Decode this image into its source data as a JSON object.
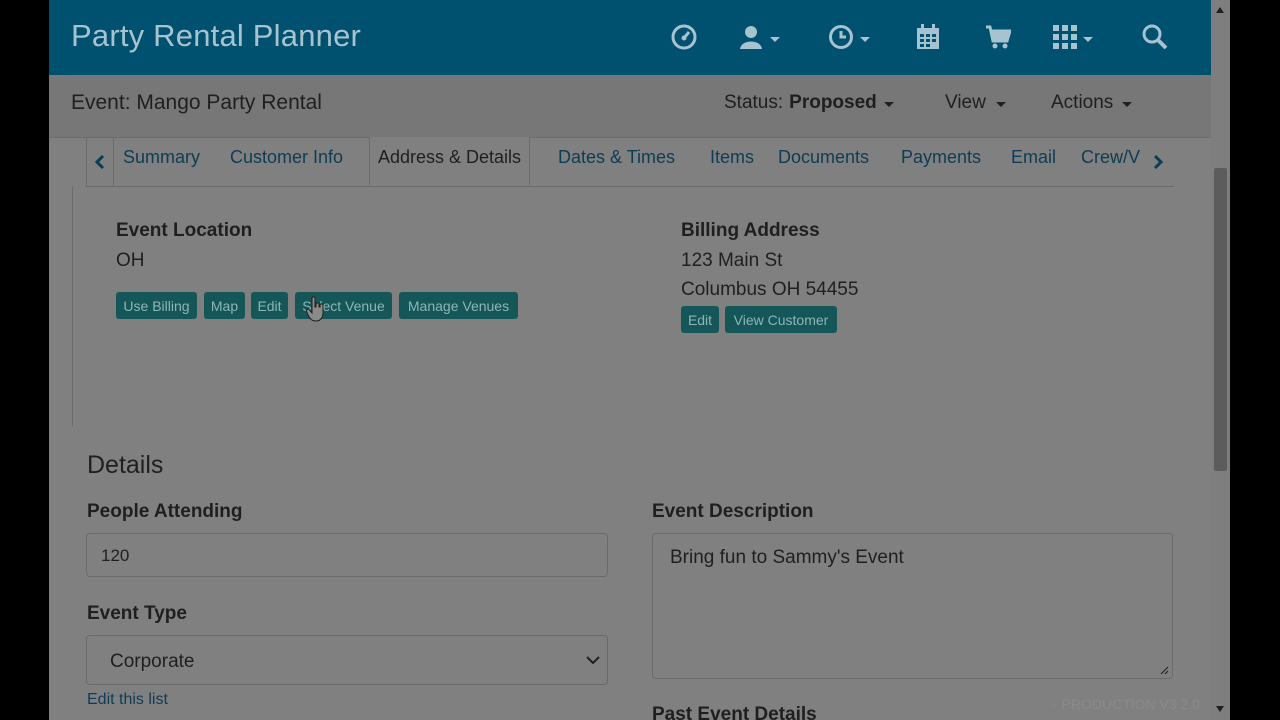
{
  "app": {
    "title": "Party Rental Planner"
  },
  "topnav": {
    "icons": [
      "dashboard-icon",
      "user-icon",
      "clock-icon",
      "calendar-icon",
      "cart-icon",
      "grid-icon",
      "search-icon"
    ]
  },
  "header": {
    "event_title": "Event: Mango Party Rental",
    "status_label": "Status:",
    "status_value": "Proposed",
    "view_label": "View",
    "actions_label": "Actions"
  },
  "tabs": [
    {
      "label": "Summary"
    },
    {
      "label": "Customer Info"
    },
    {
      "label": "Address & Details",
      "active": true
    },
    {
      "label": "Dates & Times"
    },
    {
      "label": "Items"
    },
    {
      "label": "Documents"
    },
    {
      "label": "Payments"
    },
    {
      "label": "Email"
    },
    {
      "label": "Crew/V"
    }
  ],
  "event_location": {
    "heading": "Event Location",
    "value": "OH",
    "buttons": [
      "Use Billing",
      "Map",
      "Edit",
      "Select Venue",
      "Manage Venues"
    ]
  },
  "billing_address": {
    "heading": "Billing Address",
    "line1": "123 Main St",
    "line2": "Columbus OH 54455",
    "buttons": [
      "Edit",
      "View Customer"
    ]
  },
  "details": {
    "heading": "Details",
    "people_label": "People Attending",
    "people_value": "120",
    "event_type_label": "Event Type",
    "event_type_value": "Corporate",
    "edit_list_link": "Edit this list",
    "description_label": "Event Description",
    "description_value": "Bring fun to Sammy's Event",
    "past_details_label": "Past Event Details"
  },
  "footer": {
    "watermark": "- PRODUCTION V3.2.0"
  },
  "colors": {
    "topbar": "#00506f",
    "button": "#155759",
    "overlay": "#808080"
  }
}
